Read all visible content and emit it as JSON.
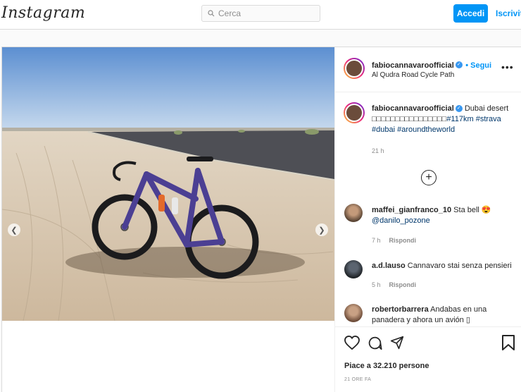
{
  "topbar": {
    "logo": "Instagram",
    "search_placeholder": "Cerca",
    "login_label": "Accedi",
    "signup_label": "Iscriviti"
  },
  "post": {
    "username": "fabiocannavaroofficial",
    "follow_label": "• Segui",
    "location": "Al Qudra Road Cycle Path",
    "caption_text": "Dubai desert",
    "caption_line2": "□□□□□□□□□□□□□□□□",
    "caption_tags": [
      "#117km",
      "#strava",
      "#dubai",
      "#aroundtheworld"
    ],
    "caption_time": "21 h",
    "likes": "Piace a 32.210 persone",
    "posted_ago": "21 ORE FA"
  },
  "comments": [
    {
      "user": "maffei_gianfranco_10",
      "text": "Sta bell 😍",
      "mention": "@danilo_pozone",
      "time": "7 h",
      "reply": "Rispondi"
    },
    {
      "user": "a.d.lauso",
      "text": "Cannavaro stai senza pensieri",
      "time": "5 h",
      "reply": "Rispondi"
    },
    {
      "user": "robertorbarrera",
      "text": "Andabas en una panadera y ahora un avión ▯"
    }
  ],
  "icons": [
    "search-icon",
    "more-options-icon",
    "add-comment-icon",
    "heart-icon",
    "comment-icon",
    "share-icon",
    "bookmark-icon",
    "chevron-left-icon",
    "chevron-right-icon",
    "verified-badge-icon"
  ],
  "colors": {
    "accent": "#0095f6",
    "hashtag": "#00376b",
    "verified": "#3897f0",
    "bike": "#4b3f93"
  }
}
